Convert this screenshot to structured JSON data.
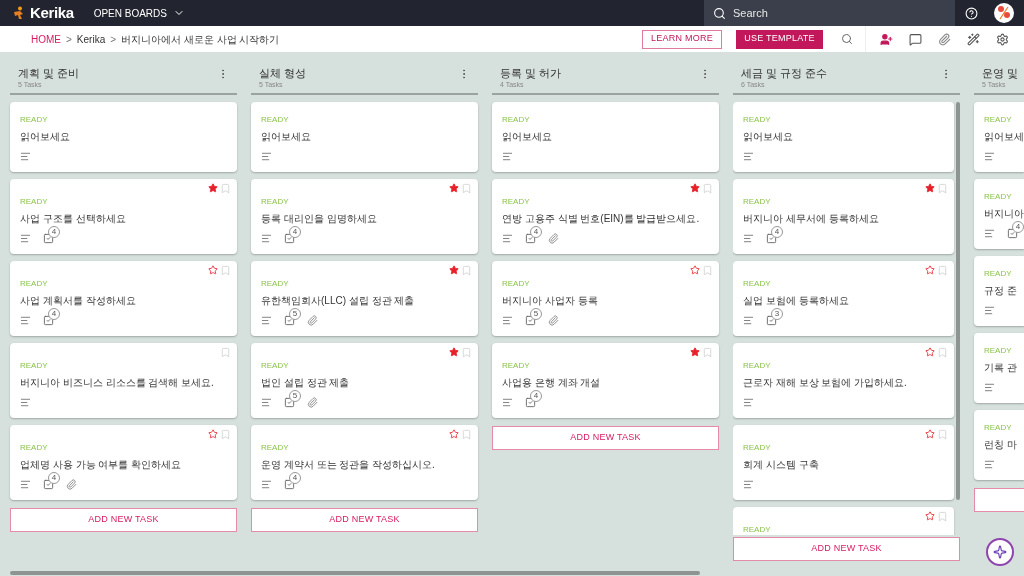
{
  "topbar": {
    "brand": "Kerika",
    "menu": "OPEN BOARDS",
    "search": {
      "placeholder": "Search"
    }
  },
  "toolbar": {
    "breadcrumb": [
      "HOME",
      "Kerika",
      "버지니아에서 새로운 사업 시작하기"
    ],
    "separators": [
      ">",
      ">"
    ],
    "buttons": [
      "LEARN MORE",
      "USE TEMPLATE"
    ]
  },
  "columns": [
    {
      "title": "계획 및 준비",
      "count": "5 Tasks",
      "add_label": "ADD NEW TASK",
      "cards": [
        {
          "status": "READY",
          "title": "읽어보세요",
          "bookmark": false,
          "description": true
        },
        {
          "status": "READY",
          "title": "사업 구조를 선택하세요",
          "starred": true,
          "bookmark": true,
          "description": true,
          "checklist": "4"
        },
        {
          "status": "READY",
          "title": "사업 계획서를 작성하세요",
          "starred": false,
          "bookmark": true,
          "description": true,
          "checklist": "4"
        },
        {
          "status": "READY",
          "title": "버지니아 비즈니스 리소스를 검색해 보세요.",
          "bookmark": true,
          "description": true
        },
        {
          "status": "READY",
          "title": "업체명 사용 가능 여부를 확인하세요",
          "starred": false,
          "bookmark": true,
          "description": true,
          "checklist": "4",
          "attachment": true
        }
      ]
    },
    {
      "title": "실체 형성",
      "count": "5 Tasks",
      "add_label": "ADD NEW TASK",
      "cards": [
        {
          "status": "READY",
          "title": "읽어보세요",
          "bookmark": false,
          "description": true
        },
        {
          "status": "READY",
          "title": "등록 대리인을 임명하세요",
          "starred": true,
          "bookmark": true,
          "description": true,
          "checklist": "4"
        },
        {
          "status": "READY",
          "title": "유한책임회사(LLC) 설립 정관 제출",
          "starred": true,
          "bookmark": true,
          "description": true,
          "checklist": "5",
          "attachment": true
        },
        {
          "status": "READY",
          "title": "법인 설립 정관 제출",
          "starred": true,
          "bookmark": true,
          "description": true,
          "checklist": "5",
          "attachment": true
        },
        {
          "status": "READY",
          "title": "운영 계약서 또는 정관을 작성하십시오.",
          "starred": false,
          "bookmark": true,
          "description": true,
          "checklist": "4"
        }
      ]
    },
    {
      "title": "등록 및 허가",
      "count": "4 Tasks",
      "add_label": "ADD NEW TASK",
      "cards": [
        {
          "status": "READY",
          "title": "읽어보세요",
          "bookmark": false,
          "description": true
        },
        {
          "status": "READY",
          "title": "연방 고용주 식별 번호(EIN)를 발급받으세요.",
          "starred": true,
          "bookmark": true,
          "description": true,
          "checklist": "4",
          "attachment": true
        },
        {
          "status": "READY",
          "title": "버지니아 사업자 등록",
          "starred": false,
          "bookmark": true,
          "description": true,
          "checklist": "5",
          "attachment": true
        },
        {
          "status": "READY",
          "title": "사업용 은행 계좌 개설",
          "starred": true,
          "bookmark": true,
          "description": true,
          "checklist": "4"
        }
      ]
    },
    {
      "title": "세금 및 규정 준수",
      "count": "6 Tasks",
      "scrolled": true,
      "add_label": "ADD NEW TASK",
      "cards": [
        {
          "status": "READY",
          "title": "읽어보세요",
          "bookmark": false,
          "description": true
        },
        {
          "status": "READY",
          "title": "버지니아 세무서에 등록하세요",
          "starred": true,
          "bookmark": true,
          "description": true,
          "checklist": "4"
        },
        {
          "status": "READY",
          "title": "실업 보험에 등록하세요",
          "starred": false,
          "bookmark": true,
          "description": true,
          "checklist": "3"
        },
        {
          "status": "READY",
          "title": "근로자 재해 보상 보험에 가입하세요.",
          "starred": false,
          "bookmark": true,
          "description": true
        },
        {
          "status": "READY",
          "title": "회계 시스템 구축",
          "starred": false,
          "bookmark": true,
          "description": true
        },
        {
          "status": "READY",
          "starred": false,
          "bookmark": true
        }
      ]
    },
    {
      "title": "운영 및",
      "count": "5 Tasks",
      "cards": [
        {
          "status": "READY",
          "title": "읽어보세",
          "description": true
        },
        {
          "status": "READY",
          "title": "버지니아",
          "description": true,
          "checklist": "4"
        },
        {
          "status": "READY",
          "title": "규정 준",
          "description": true
        },
        {
          "status": "READY",
          "title": "기록 관",
          "description": true
        },
        {
          "status": "READY",
          "title": "런칭 마",
          "description": true
        }
      ]
    }
  ]
}
